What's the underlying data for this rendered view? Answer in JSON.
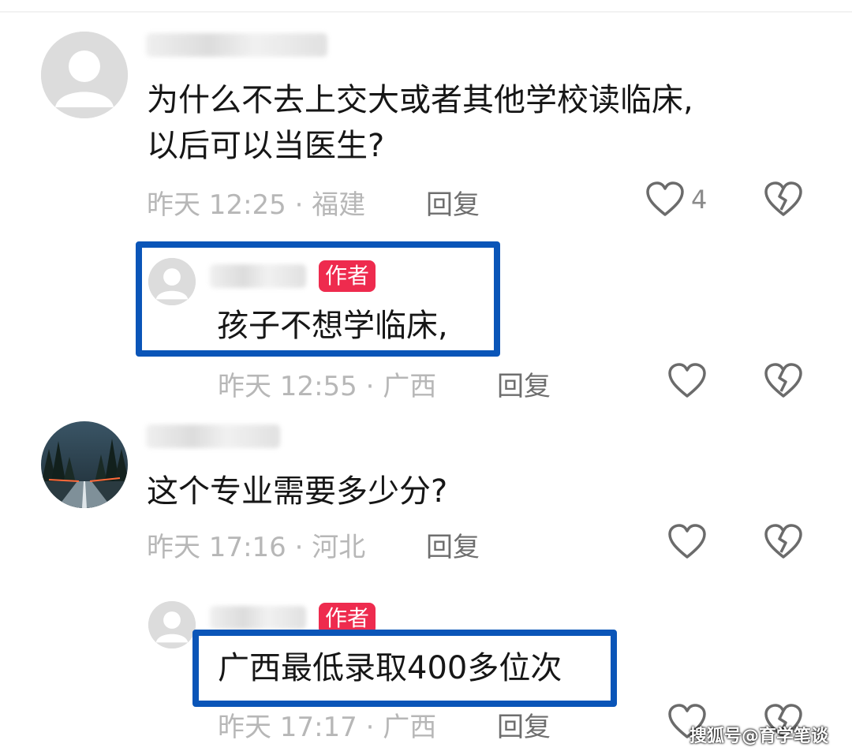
{
  "comments": [
    {
      "text_line1": "为什么不去上交大或者其他学校读临床,",
      "text_line2": "以后可以当医生?",
      "meta": "昨天 12:25 · 福建",
      "reply_label": "回复",
      "like_count": "4"
    },
    {
      "author_badge": "作者",
      "text": "孩子不想学临床,",
      "meta": "昨天 12:55 · 广西",
      "reply_label": "回复"
    },
    {
      "text": "这个专业需要多少分?",
      "meta": "昨天 17:16 · 河北",
      "reply_label": "回复"
    },
    {
      "author_badge": "作者",
      "text": "广西最低录取400多位次",
      "meta": "昨天 17:17 · 广西",
      "reply_label": "回复"
    }
  ],
  "watermark": "搜狐号@育学笔谈",
  "icons": [
    "default-avatar-icon",
    "heart-icon",
    "broken-heart-icon",
    "landscape-avatar"
  ],
  "colors": {
    "highlight_box": "#0a55b8",
    "author_badge": "#ee2b4e",
    "meta_text": "#b7b7b7"
  }
}
